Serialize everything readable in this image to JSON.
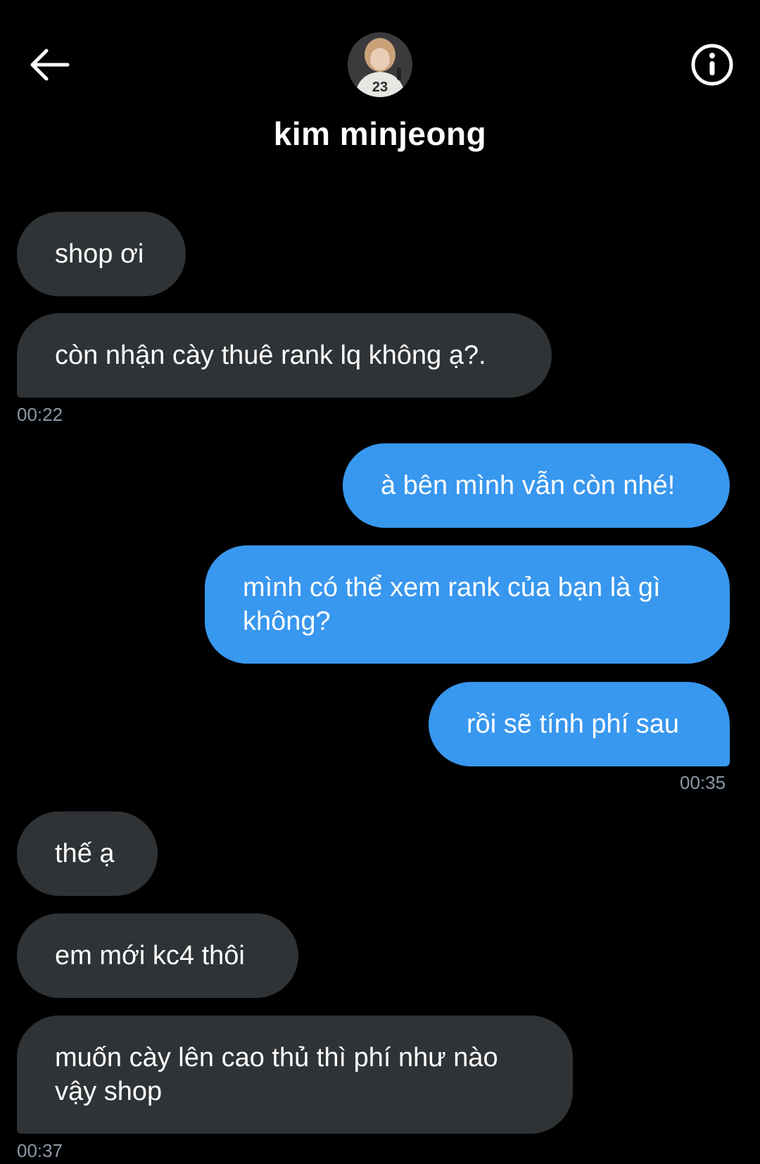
{
  "header": {
    "contact_name": "kim minjeong",
    "avatar_jersey_number": "23"
  },
  "messages": [
    {
      "side": "in",
      "text": "shop ơi"
    },
    {
      "side": "in",
      "text": "còn nhận cày thuê rank lq không ạ?."
    },
    {
      "side": "out",
      "text": "à bên mình vẫn còn nhé!"
    },
    {
      "side": "out",
      "text": "mình có thể xem rank của bạn là gì không?"
    },
    {
      "side": "out",
      "text": "rồi sẽ tính phí sau"
    },
    {
      "side": "in",
      "text": "thế ạ"
    },
    {
      "side": "in",
      "text": "em mới kc4 thôi"
    },
    {
      "side": "in",
      "text": "muốn cày lên cao thủ thì phí như nào vậy shop"
    }
  ],
  "timestamps": [
    "00:22",
    "00:35",
    "00:37"
  ],
  "colors": {
    "incoming_bubble": "#2f3336",
    "outgoing_bubble": "#3897ef",
    "background": "#000000",
    "timestamp": "#8b98a5"
  },
  "icons": [
    "arrow-left-icon",
    "info-circle-icon"
  ]
}
